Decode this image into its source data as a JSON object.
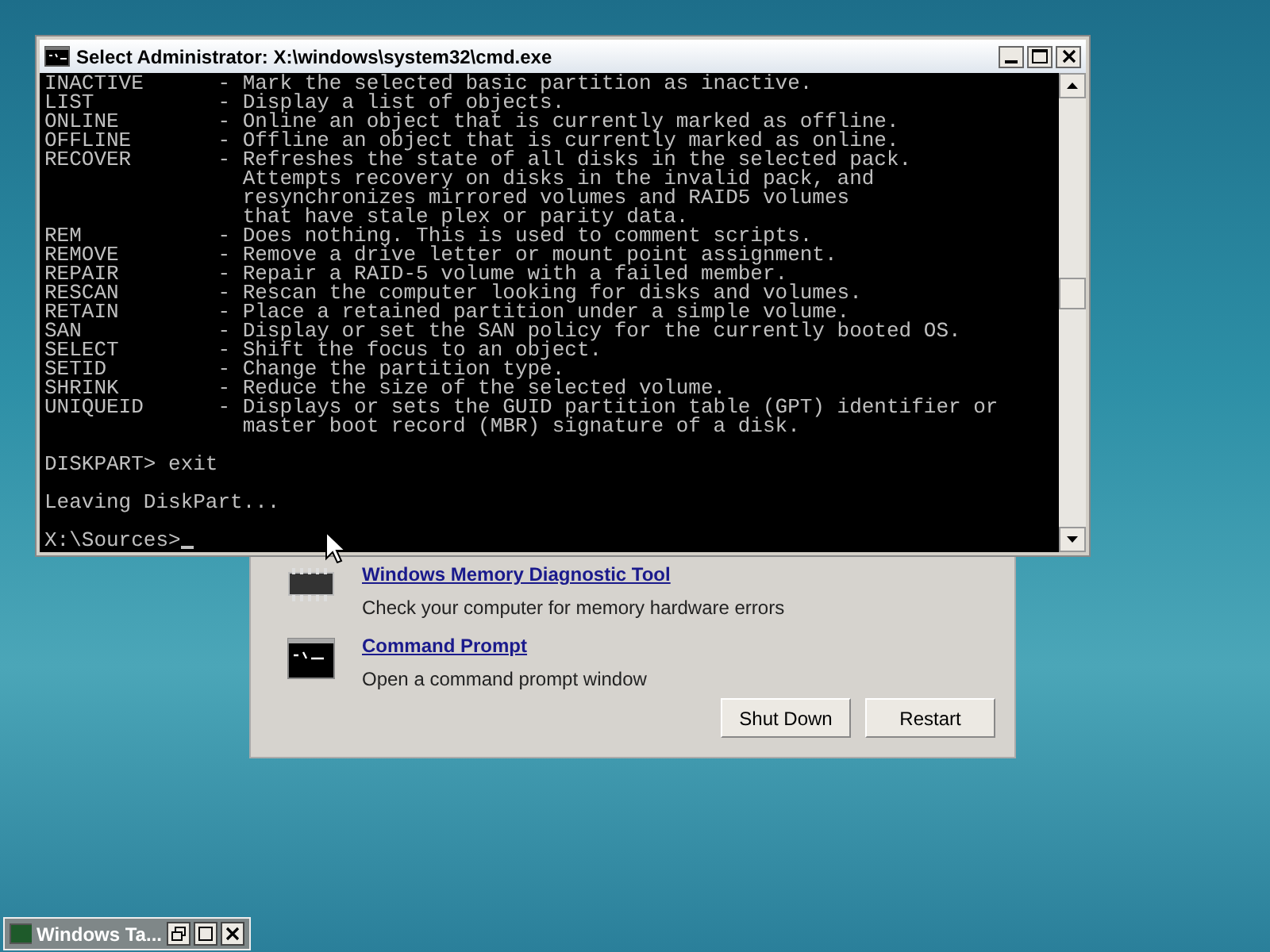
{
  "console_window": {
    "title": "Select Administrator: X:\\windows\\system32\\cmd.exe",
    "blocks": [
      [
        "INACTIVE      - Mark the selected basic partition as inactive.",
        "LIST          - Display a list of objects.",
        "ONLINE        - Online an object that is currently marked as offline.",
        "OFFLINE       - Offline an object that is currently marked as online.",
        "RECOVER       - Refreshes the state of all disks in the selected pack.",
        "                Attempts recovery on disks in the invalid pack, and",
        "                resynchronizes mirrored volumes and RAID5 volumes",
        "                that have stale plex or parity data.",
        "REM           - Does nothing. This is used to comment scripts.",
        "REMOVE        - Remove a drive letter or mount point assignment.",
        "REPAIR        - Repair a RAID-5 volume with a failed member.",
        "RESCAN        - Rescan the computer looking for disks and volumes.",
        "RETAIN        - Place a retained partition under a simple volume.",
        "SAN           - Display or set the SAN policy for the currently booted OS.",
        "SELECT        - Shift the focus to an object.",
        "SETID         - Change the partition type.",
        "SHRINK        - Reduce the size of the selected volume.",
        "UNIQUEID      - Displays or sets the GUID partition table (GPT) identifier or",
        "                master boot record (MBR) signature of a disk."
      ],
      [
        "DISKPART> exit"
      ],
      [
        "Leaving DiskPart..."
      ]
    ],
    "prompt": "X:\\Sources>"
  },
  "recovery_dialog": {
    "tools": [
      {
        "kind": "memory",
        "link": "Windows Memory Diagnostic Tool",
        "description": "Check your computer for memory hardware errors"
      },
      {
        "kind": "console",
        "link": "Command Prompt",
        "description": "Open a command prompt window"
      }
    ],
    "buttons": [
      "Shut Down",
      "Restart"
    ]
  },
  "minimized_window": {
    "title": "Windows Ta..."
  }
}
